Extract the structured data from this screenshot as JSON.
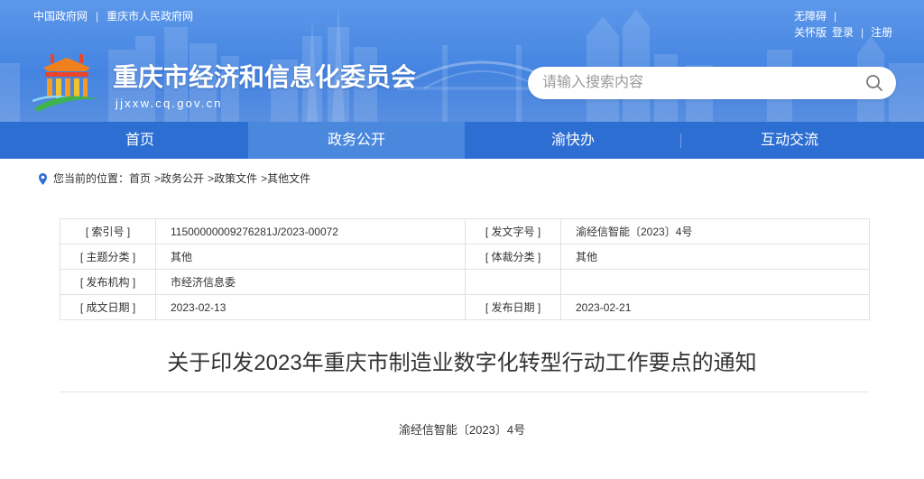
{
  "top_links": {
    "gov_cn": "中国政府网",
    "separator": "|",
    "cq_gov": "重庆市人民政府网"
  },
  "top_right": {
    "accessibility": "无障碍",
    "separator": "|",
    "care_mode": "关怀版",
    "login": "登录",
    "register": "注册"
  },
  "site": {
    "title": "重庆市经济和信息化委员会",
    "domain": "jjxxw.cq.gov.cn"
  },
  "search": {
    "placeholder": "请输入搜索内容"
  },
  "nav": [
    {
      "label": "首页",
      "active": false
    },
    {
      "label": "政务公开",
      "active": true
    },
    {
      "label": "渝快办",
      "active": false
    },
    {
      "label": "互动交流",
      "active": false
    }
  ],
  "breadcrumb": {
    "prefix": "您当前的位置：",
    "separator": ">",
    "items": [
      "首页",
      "政务公开",
      "政策文件",
      "其他文件"
    ]
  },
  "info_table": {
    "rows": [
      {
        "left_label": "[ 索引号 ]",
        "left_value": "11500000009276281J/2023-00072",
        "right_label": "[ 发文字号 ]",
        "right_value": "渝经信智能〔2023〕4号"
      },
      {
        "left_label": "[ 主题分类 ]",
        "left_value": "其他",
        "right_label": "[ 体裁分类 ]",
        "right_value": "其他"
      },
      {
        "left_label": "[ 发布机构 ]",
        "left_value": "市经济信息委",
        "right_label": "",
        "right_value": ""
      },
      {
        "left_label": "[ 成文日期 ]",
        "left_value": "2023-02-13",
        "right_label": "[ 发布日期 ]",
        "right_value": "2023-02-21"
      }
    ]
  },
  "article": {
    "title": "关于印发2023年重庆市制造业数字化转型行动工作要点的通知",
    "doc_number": "渝经信智能〔2023〕4号"
  },
  "icons": {
    "logo": "site-logo-icon",
    "search": "search-icon",
    "location": "location-pin-icon"
  },
  "colors": {
    "banner_top": "#5c98ea",
    "banner_bottom": "#3476da",
    "nav": "#2d6ed3",
    "nav_active": "#4a88de",
    "accent": "#2f6fd3",
    "border": "#e2e2e2"
  }
}
